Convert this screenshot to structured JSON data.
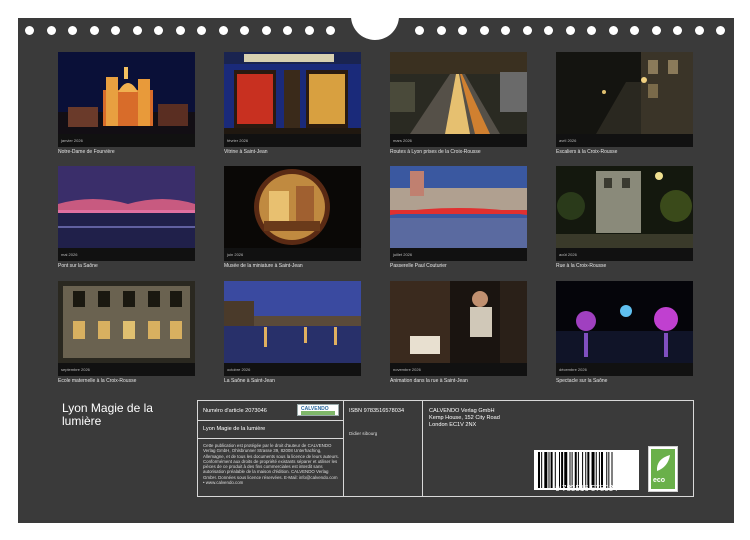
{
  "tiles": [
    {
      "month": "janvier 2026",
      "caption": "Notre-Dame de Fourvière"
    },
    {
      "month": "février 2026",
      "caption": "Vitrine à Saint-Jean"
    },
    {
      "month": "mars 2026",
      "caption": "Routes à Lyon prises de la Croix-Rousse"
    },
    {
      "month": "avril 2026",
      "caption": "Escaliers à la Croix-Rousse"
    },
    {
      "month": "mai 2026",
      "caption": "Pont sur la Saône"
    },
    {
      "month": "juin 2026",
      "caption": "Musée de la miniature à Saint-Jean"
    },
    {
      "month": "juillet 2026",
      "caption": "Passerelle Paul Couturier"
    },
    {
      "month": "août 2026",
      "caption": "Rue à la Croix-Rousse"
    },
    {
      "month": "septembre 2026",
      "caption": "Ecole maternelle à la Croix-Rousse"
    },
    {
      "month": "octobre 2026",
      "caption": "La Saône à Saint-Jean"
    },
    {
      "month": "novembre 2026",
      "caption": "Animation dans la rue à Saint-Jean"
    },
    {
      "month": "décembre 2026",
      "caption": "Spectacle sur la Saône"
    }
  ],
  "calendar_title": "Lyon Magie de la lumière",
  "info": {
    "article_label": "Numéro d'article 2073046",
    "product_title": "Lyon Magie de la lumière",
    "legal_text": "Cette publication est protégée par le droit d'auteur de CALVENDO Verlag GmbH, Ohlsbrunner Strasse 39, 82008 Unterhaching, Allemagne, et de tous les documents sous la licence de leurs auteurs. Conformément aux droits de propriété existants séparer et utiliser les pièces de ce produit à des fins commerciales est interdit sans autorisation préalable de la maison d'édition. CALVENDO Verlag GmbH. Données sous licence réservées. E-Mail: info@calvendo.com • www.calvendo.com",
    "isbn": "ISBN 9783516578034",
    "author": "Didier sibourg",
    "publisher_name": "CALVENDO Verlag GmbH",
    "publisher_address1": "Kemp House, 152 City Road",
    "publisher_address2": "London EC1V 2NX",
    "barcode_digits": "9 783516 578034",
    "logo_text": "CALVENDO",
    "eco_label": "eco"
  }
}
